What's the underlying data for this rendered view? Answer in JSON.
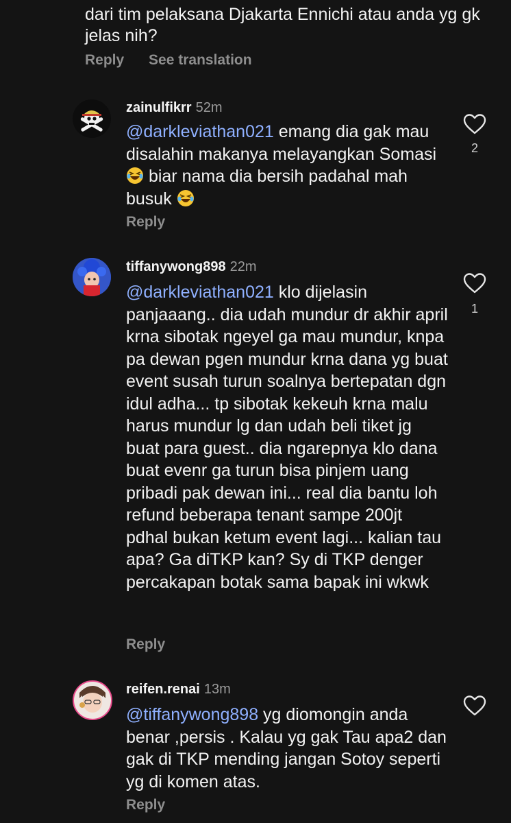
{
  "top_comment": {
    "text": "dari tim pelaksana Djakarta Ennichi atau anda yg gk jelas nih?",
    "reply_label": "Reply",
    "translate_label": "See translation"
  },
  "comments": [
    {
      "username": "zainulfikrr",
      "time": "52m",
      "mention": "@darkleviathan021",
      "text_parts": [
        " emang dia gak mau disalahin makanya melayangkan Somasi ",
        " biar nama dia bersih padahal mah busuk "
      ],
      "emoji": "laughing-emoji",
      "likes": "2",
      "reply_label": "Reply"
    },
    {
      "username": "tiffanywong898",
      "time": "22m",
      "mention": "@darkleviathan021",
      "text": " klo dijelasin panjaaang.. dia udah mundur dr akhir april krna sibotak ngeyel ga mau mundur, knpa pa dewan pgen mundur krna dana yg buat event susah turun soalnya bertepatan dgn idul adha... tp sibotak kekeuh krna malu harus mundur lg dan udah beli tiket jg buat para guest.. dia ngarepnya klo dana buat evenr ga turun bisa pinjem uang pribadi pak dewan ini... real dia bantu loh refund beberapa tenant sampe 200jt pdhal bukan ketum event lagi... kalian tau apa? Ga diTKP kan? Sy di TKP denger percakapan botak sama bapak ini wkwk",
      "likes": "1",
      "reply_label": "Reply"
    },
    {
      "username": "reifen.renai",
      "time": "13m",
      "mention": "@tiffanywong898",
      "text": " yg diomongin anda benar ,persis . Kalau yg gak Tau apa2 dan gak di TKP mending jangan Sotoy seperti yg di komen atas.",
      "reply_label": "Reply"
    }
  ],
  "icons": {
    "heart": "heart-outline-icon",
    "colors": {
      "mention": "#8fb0ff",
      "muted": "#8e8e8e",
      "bg": "#141414"
    }
  }
}
